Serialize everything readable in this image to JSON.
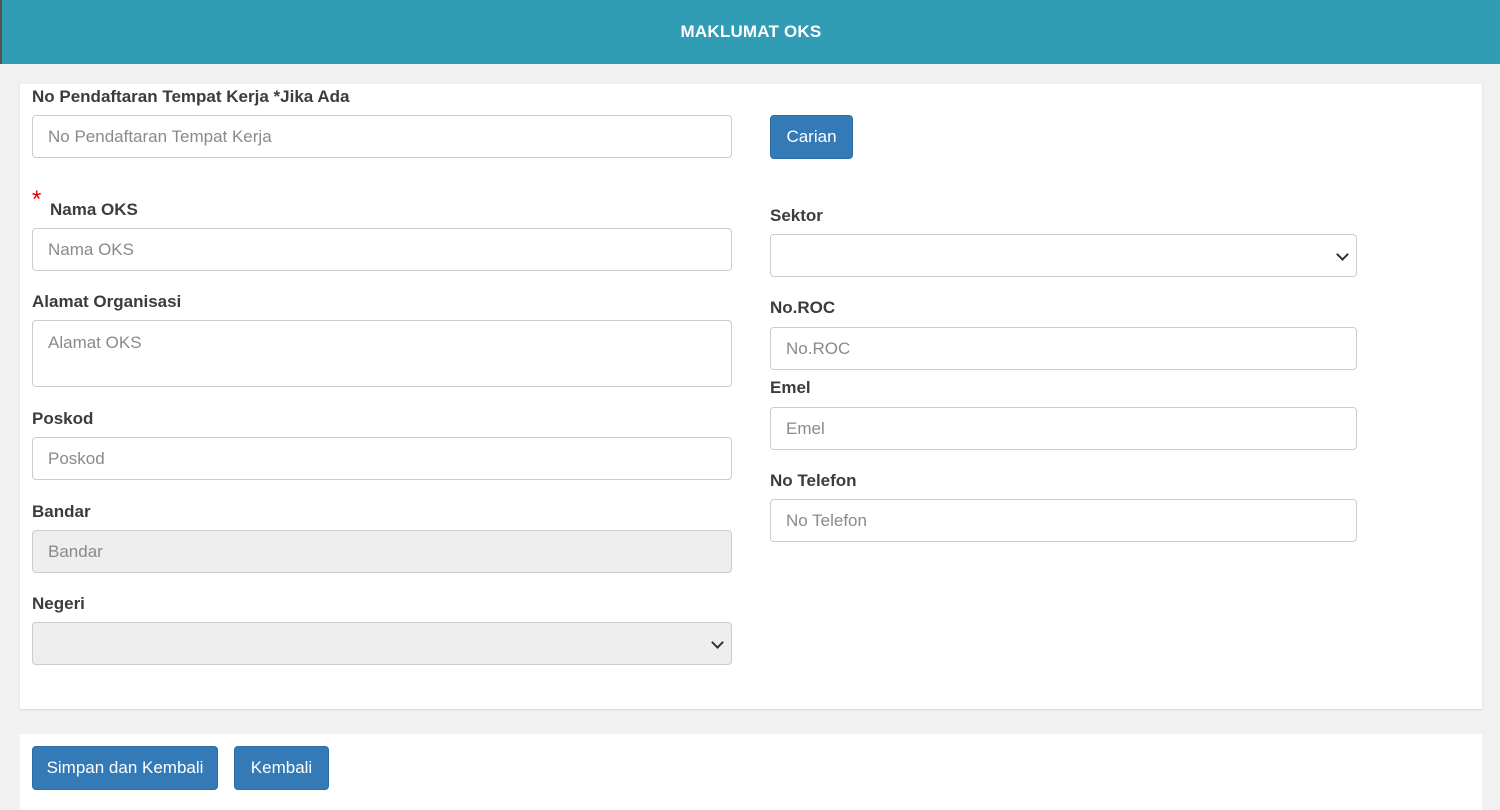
{
  "header": {
    "title": "MAKLUMAT OKS"
  },
  "form": {
    "no_pendaftaran": {
      "label": "No Pendaftaran Tempat Kerja *Jika Ada",
      "placeholder": "No Pendaftaran Tempat Kerja",
      "value": ""
    },
    "carian_button": "Carian",
    "required_mark": "*",
    "nama_oks": {
      "label": "Nama OKS",
      "placeholder": "Nama OKS",
      "value": ""
    },
    "alamat": {
      "label": "Alamat Organisasi",
      "placeholder": "Alamat OKS",
      "value": ""
    },
    "poskod": {
      "label": "Poskod",
      "placeholder": "Poskod",
      "value": ""
    },
    "bandar": {
      "label": "Bandar",
      "placeholder": "Bandar",
      "value": ""
    },
    "negeri": {
      "label": "Negeri",
      "selected": ""
    },
    "sektor": {
      "label": "Sektor",
      "selected": ""
    },
    "no_roc": {
      "label": "No.ROC",
      "placeholder": "No.ROC",
      "value": ""
    },
    "emel": {
      "label": "Emel",
      "placeholder": "Emel",
      "value": ""
    },
    "no_telefon": {
      "label": "No Telefon",
      "placeholder": "No Telefon",
      "value": ""
    }
  },
  "footer": {
    "save_button": "Simpan dan Kembali",
    "back_button": "Kembali"
  }
}
